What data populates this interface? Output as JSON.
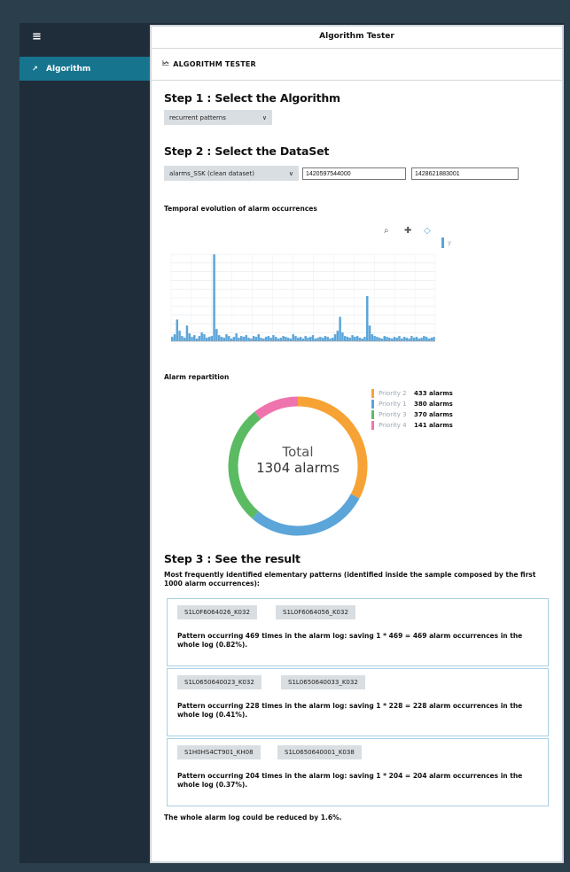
{
  "sidebar": {
    "menu_icon": "hamburger-icon",
    "items": [
      {
        "label": "Algorithm",
        "icon": "chart-icon"
      }
    ]
  },
  "window": {
    "title": "Algorithm Tester"
  },
  "page": {
    "heading": "ALGORITHM TESTER",
    "heading_icon": "chart-icon"
  },
  "step1": {
    "title": "Step 1 : Select the Algorithm",
    "algorithm_value": "recurrent patterns"
  },
  "step2": {
    "title": "Step 2 : Select the DataSet",
    "dataset_value": "alarms_SSK (clean dataset)",
    "start_value": "1420597544000",
    "end_value": "1428621883001"
  },
  "temporal_chart": {
    "title": "Temporal evolution of alarm occurrences",
    "legend_label": "y"
  },
  "repartition": {
    "title": "Alarm repartition",
    "total_label": "Total",
    "total_value": "1304 alarms",
    "legend": [
      {
        "priority": "Priority 2",
        "count": "433 alarms",
        "color": "#f7a234"
      },
      {
        "priority": "Priority 1",
        "count": "380 alarms",
        "color": "#5ba5d9"
      },
      {
        "priority": "Priority 3",
        "count": "370 alarms",
        "color": "#5bbb63"
      },
      {
        "priority": "Priority 4",
        "count": "141 alarms",
        "color": "#ef74ad"
      }
    ]
  },
  "step3": {
    "title": "Step 3 : See the result",
    "intro": "Most frequently identified elementary patterns (identified inside the sample composed by the first 1000 alarm occurrences):",
    "patterns": [
      {
        "chips": [
          "S1L0F6064026_K032",
          "S1L0F6064056_K032"
        ],
        "text": "Pattern occurring 469 times in the alarm log: saving 1 * 469 = 469 alarm occurrences in the whole log (0.82%)."
      },
      {
        "chips": [
          "S1L0650640023_K032",
          "S1L0650640033_K032"
        ],
        "text": "Pattern occurring 228 times in the alarm log: saving 1 * 228 = 228 alarm occurrences in the whole log (0.41%)."
      },
      {
        "chips": [
          "S1H0HS4CT901_KH08",
          "S1L0650640001_K038"
        ],
        "text": "Pattern occurring 204 times in the alarm log: saving 1 * 204 = 204 alarm occurrences in the whole log (0.37%)."
      }
    ],
    "summary": "The whole alarm log could be reduced by 1.6%."
  },
  "chart_data": [
    {
      "type": "bar",
      "title": "Temporal evolution of alarm occurrences",
      "xlabel": "",
      "ylabel": "",
      "grid": true,
      "series": [
        {
          "name": "y",
          "color": "#5ba5d9",
          "values": [
            5,
            8,
            25,
            12,
            6,
            4,
            18,
            9,
            5,
            7,
            3,
            6,
            10,
            8,
            4,
            5,
            6,
            100,
            14,
            7,
            5,
            4,
            8,
            6,
            3,
            5,
            9,
            4,
            6,
            5,
            7,
            4,
            3,
            6,
            5,
            8,
            4,
            3,
            5,
            6,
            4,
            7,
            5,
            3,
            4,
            6,
            5,
            4,
            3,
            8,
            6,
            4,
            5,
            3,
            6,
            4,
            5,
            7,
            3,
            4,
            5,
            4,
            6,
            5,
            3,
            4,
            8,
            12,
            28,
            10,
            6,
            5,
            4,
            7,
            5,
            6,
            4,
            3,
            5,
            52,
            18,
            8,
            6,
            5,
            4,
            3,
            6,
            5,
            4,
            3,
            5,
            4,
            6,
            3,
            5,
            4,
            3,
            6,
            4,
            5,
            3,
            4,
            6,
            5,
            3,
            4,
            5
          ]
        }
      ]
    },
    {
      "type": "pie",
      "title": "Alarm repartition",
      "categories": [
        "Priority 2",
        "Priority 1",
        "Priority 3",
        "Priority 4"
      ],
      "values": [
        433,
        380,
        370,
        141
      ]
    }
  ]
}
